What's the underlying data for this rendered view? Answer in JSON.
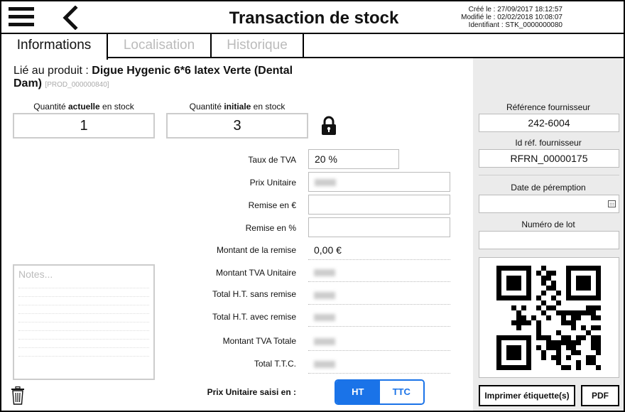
{
  "header": {
    "title": "Transaction de stock",
    "created": "Créé le : 27/09/2017 18:12:57",
    "modified": "Modifié le : 02/02/2018 10:08:07",
    "identifier": "Identifiant : STK_0000000080"
  },
  "tabs": [
    {
      "label": "Informations",
      "active": true
    },
    {
      "label": "Localisation",
      "active": false
    },
    {
      "label": "Historique",
      "active": false
    }
  ],
  "product": {
    "prefix": "Lié au produit : ",
    "name": "Digue Hygenic 6*6 latex Verte (Dental Dam)",
    "code": "[PROD_000000840]"
  },
  "quantities": {
    "current_label_pre": "Quantité ",
    "current_label_bold": "actuelle",
    "current_label_post": " en stock",
    "current_value": "1",
    "initial_label_pre": "Quantité ",
    "initial_label_bold": "initiale",
    "initial_label_post": " en stock",
    "initial_value": "3"
  },
  "fields": {
    "tva_label": "Taux de TVA",
    "tva_value": "20 %",
    "prix_unitaire_label": "Prix Unitaire",
    "remise_eur_label": "Remise en €",
    "remise_pct_label": "Remise en %",
    "montant_remise_label": "Montant de la remise",
    "montant_remise_value": "0,00 €",
    "montant_tva_unitaire_label": "Montant TVA Unitaire",
    "total_ht_sans_label": "Total H.T. sans remise",
    "total_ht_avec_label": "Total H.T. avec remise",
    "montant_tva_totale_label": "Montant TVA Totale",
    "total_ttc_label": "Total T.T.C."
  },
  "notes": {
    "placeholder": "Notes..."
  },
  "price_mode": {
    "label": "Prix Unitaire saisi en :",
    "ht": "HT",
    "ttc": "TTC",
    "selected": "HT"
  },
  "right_panel": {
    "ref_fournisseur_label": "Référence fournisseur",
    "ref_fournisseur_value": "242-6004",
    "id_ref_label": "Id réf. fournisseur",
    "id_ref_value": "RFRN_00000175",
    "peremption_label": "Date de péremption",
    "lot_label": "Numéro de lot",
    "print_button": "Imprimer étiquette(s)",
    "pdf_button": "PDF"
  },
  "colors": {
    "accent": "#1a73e8",
    "panel_bg": "#ebebeb"
  },
  "icons": [
    "menu-icon",
    "back-icon",
    "lock-icon",
    "calendar-icon",
    "trash-icon"
  ]
}
